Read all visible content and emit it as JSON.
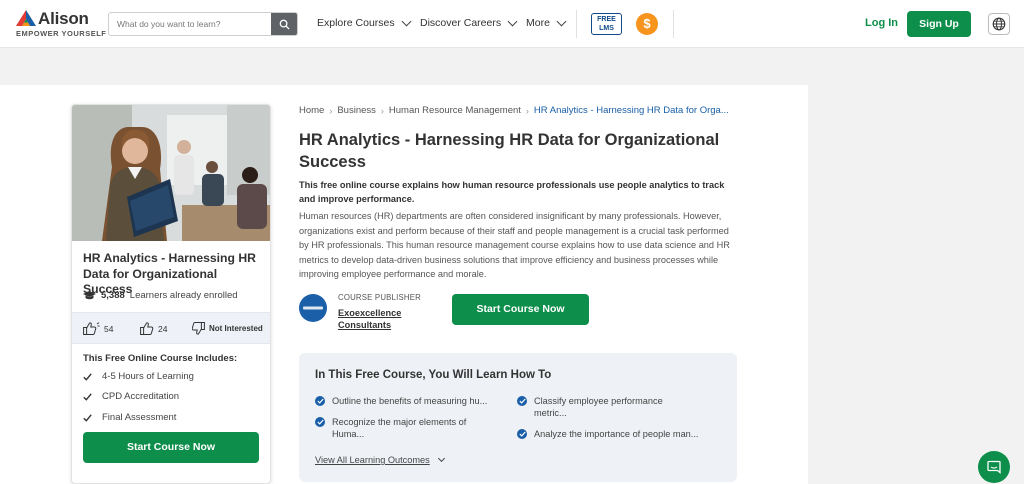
{
  "brand": {
    "name": "Alison",
    "tagline": "EMPOWER YOURSELF",
    "colors": {
      "green": "#0d8e4a",
      "blue": "#1a5fa8",
      "orange": "#f7941d"
    }
  },
  "header": {
    "search_placeholder": "What do you want to learn?",
    "nav": [
      "Explore Courses",
      "Discover Careers",
      "More"
    ],
    "free_lms_line1": "FREE",
    "free_lms_line2": "LMS",
    "coin_symbol": "$",
    "login": "Log In",
    "signup": "Sign Up"
  },
  "card": {
    "title": "HR Analytics - Harnessing HR Data for Organizational Success",
    "enrolled_count": "5,388",
    "enrolled_label": "Learners already enrolled",
    "likes": "54",
    "shares": "24",
    "not_interested": "Not Interested",
    "includes_title": "This Free Online Course Includes:",
    "includes": [
      "4-5 Hours of Learning",
      "CPD Accreditation",
      "Final Assessment"
    ],
    "cta": "Start Course Now"
  },
  "breadcrumb": [
    "Home",
    "Business",
    "Human Resource Management",
    "HR Analytics - Harnessing HR Data for Orga..."
  ],
  "course": {
    "title": "HR Analytics - Harnessing HR Data for Organizational Success",
    "lead": "This free online course explains how human resource professionals use people analytics to track and improve performance.",
    "description": "Human resources (HR) departments are often considered insignificant by many professionals. However, organizations exist and perform because of their staff and people management is a crucial task performed by HR professionals. This human resource management course explains how to use data science and HR metrics to develop data-driven business solutions that improve efficiency and business processes while improving employee performance and morale.",
    "publisher_label": "COURSE PUBLISHER",
    "publisher_name": "Exoexcellence Consultants",
    "cta": "Start Course Now"
  },
  "learn": {
    "title": "In This Free Course, You Will Learn How To",
    "outcomes": [
      "Outline the benefits of measuring hu...",
      "Recognize the major elements of Huma...",
      "Classify employee performance metric...",
      "Analyze the importance of people man..."
    ],
    "view_all": "View All Learning Outcomes"
  }
}
